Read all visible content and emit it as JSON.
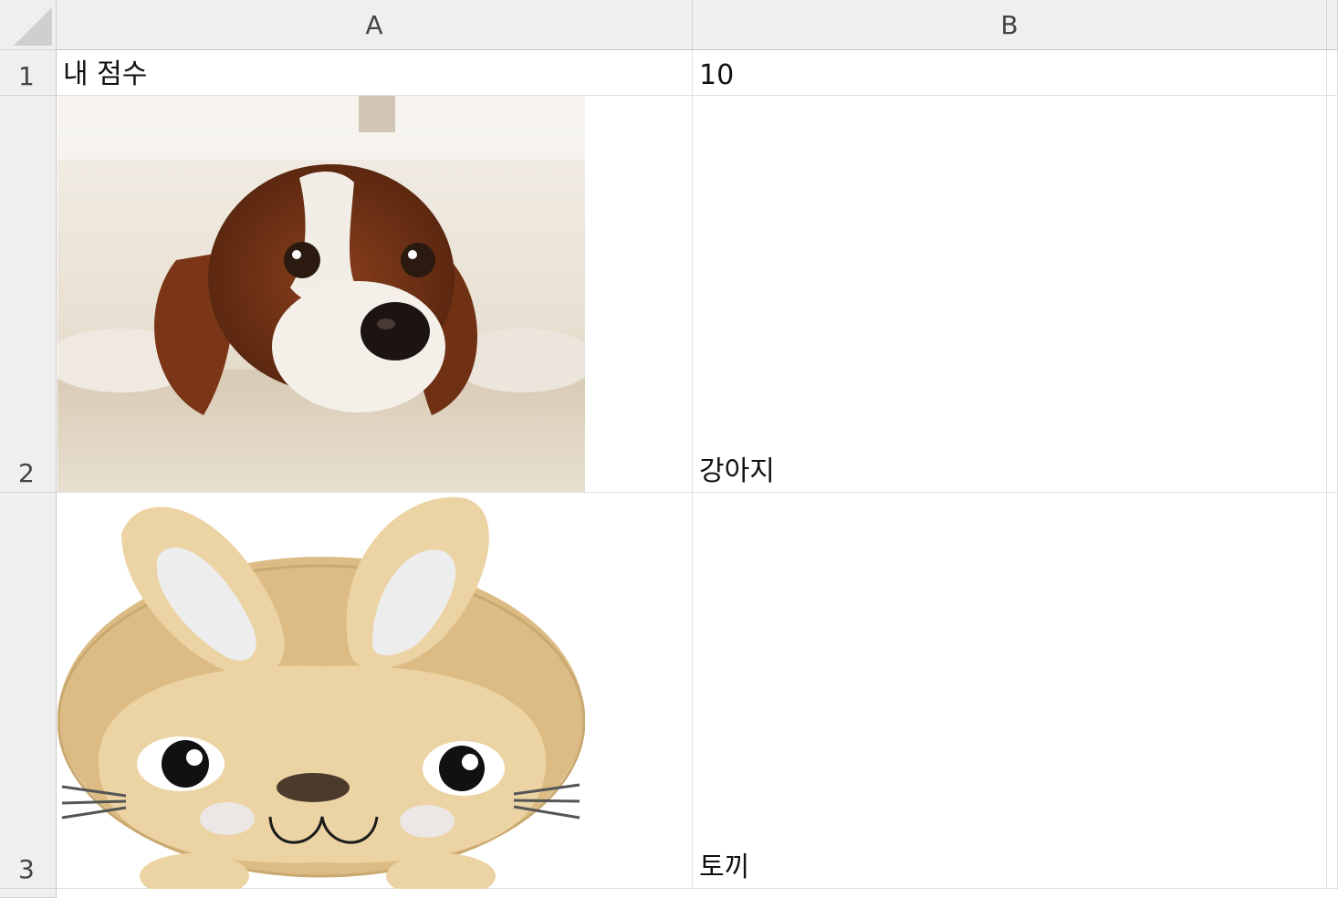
{
  "sheet": {
    "columns": [
      "A",
      "B"
    ],
    "rows": [
      "1",
      "2",
      "3"
    ],
    "cells": {
      "A1": "내 점수",
      "B1": "10",
      "B2": "강아지",
      "B3": "토끼"
    }
  },
  "images": {
    "dog": "dog-photo",
    "rabbit": "rabbit-cartoon"
  }
}
